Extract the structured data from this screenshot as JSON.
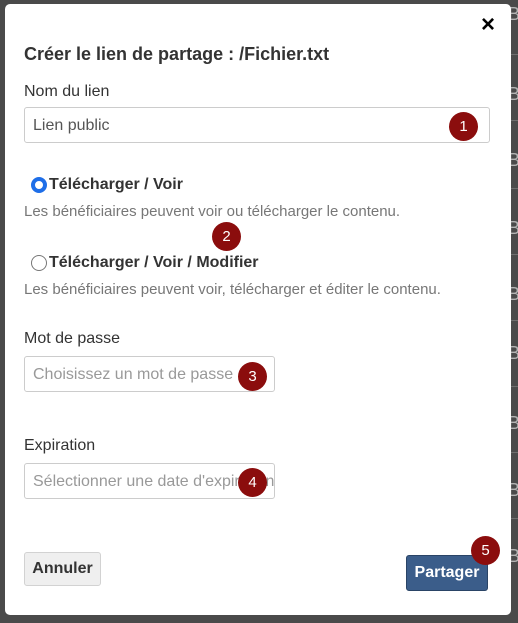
{
  "background": {
    "glyphs": [
      "B",
      "B",
      "B",
      "B",
      "B",
      "B",
      "B",
      "B",
      "B"
    ]
  },
  "modal": {
    "close_label": "×",
    "title": "Créer le lien de partage : /Fichier.txt",
    "link_name": {
      "label": "Nom du lien",
      "value": "Lien public"
    },
    "permissions": {
      "selected": "view_download",
      "options": [
        {
          "id": "view_download",
          "label": "Télécharger / Voir",
          "help": "Les bénéficiaires peuvent voir ou télécharger le contenu.",
          "checked": true
        },
        {
          "id": "view_download_edit",
          "label": "Télécharger / Voir / Modifier",
          "help": "Les bénéficiaires peuvent voir, télécharger et éditer le contenu.",
          "checked": false
        }
      ]
    },
    "password": {
      "label": "Mot de passe",
      "placeholder": "Choisissez un mot de passe"
    },
    "expiration": {
      "label": "Expiration",
      "placeholder": "Sélectionner une date d'expiration"
    },
    "buttons": {
      "cancel": "Annuler",
      "share": "Partager"
    },
    "callouts": [
      "1",
      "2",
      "3",
      "4",
      "5"
    ],
    "colors": {
      "callout": "#8b0d0d",
      "primary_button": "#3b5d8a",
      "radio_checked": "#1e6ee8"
    }
  }
}
